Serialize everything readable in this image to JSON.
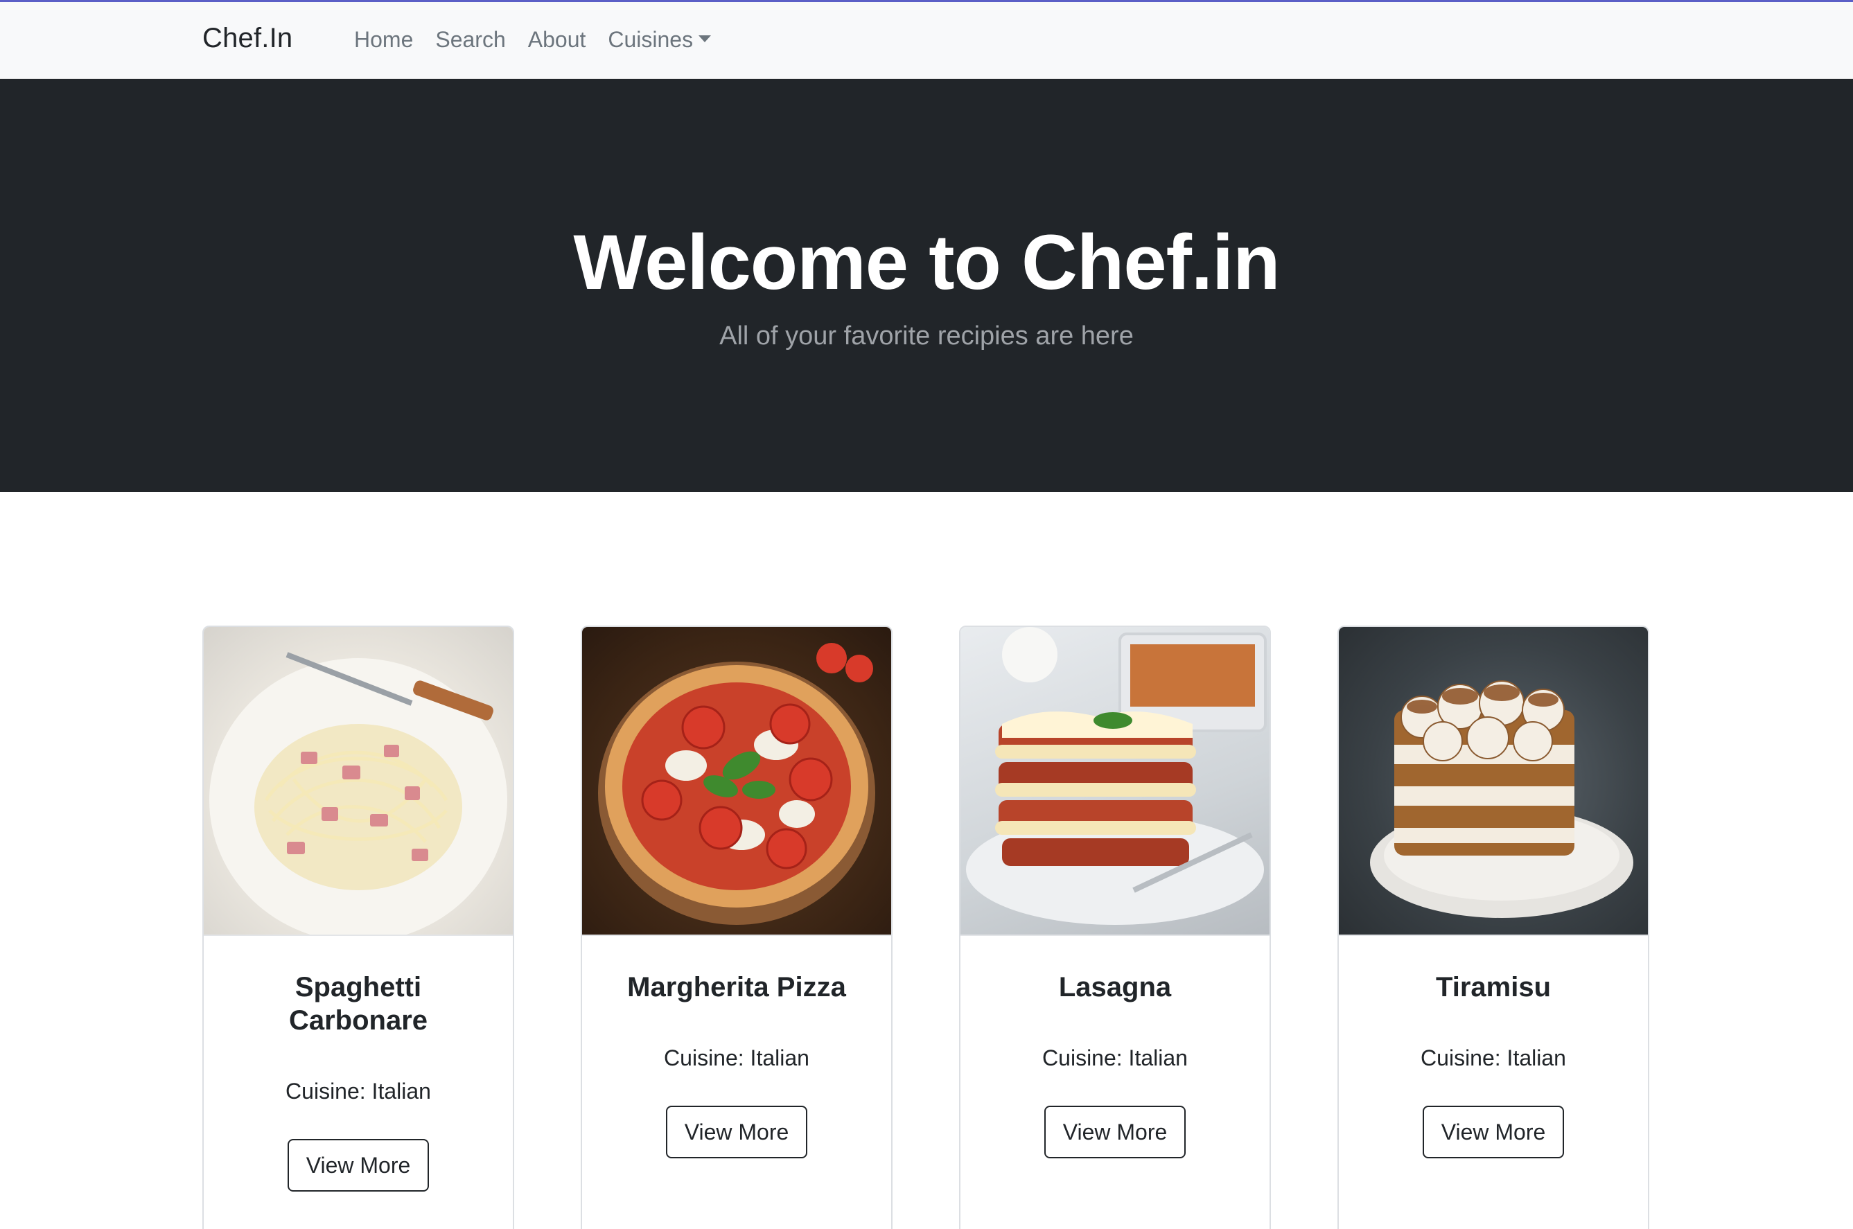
{
  "navbar": {
    "brand": "Chef.In",
    "links": [
      "Home",
      "Search",
      "About"
    ],
    "dropdown_label": "Cuisines"
  },
  "hero": {
    "title": "Welcome to Chef.in",
    "subtitle": "All of your favorite recipies are here"
  },
  "recipes": [
    {
      "title": "Spaghetti Carbonare",
      "cuisine": "Cuisine: Italian",
      "button": "View More"
    },
    {
      "title": "Margherita Pizza",
      "cuisine": "Cuisine: Italian",
      "button": "View More"
    },
    {
      "title": "Lasagna",
      "cuisine": "Cuisine: Italian",
      "button": "View More"
    },
    {
      "title": "Tiramisu",
      "cuisine": "Cuisine: Italian",
      "button": "View More"
    }
  ]
}
